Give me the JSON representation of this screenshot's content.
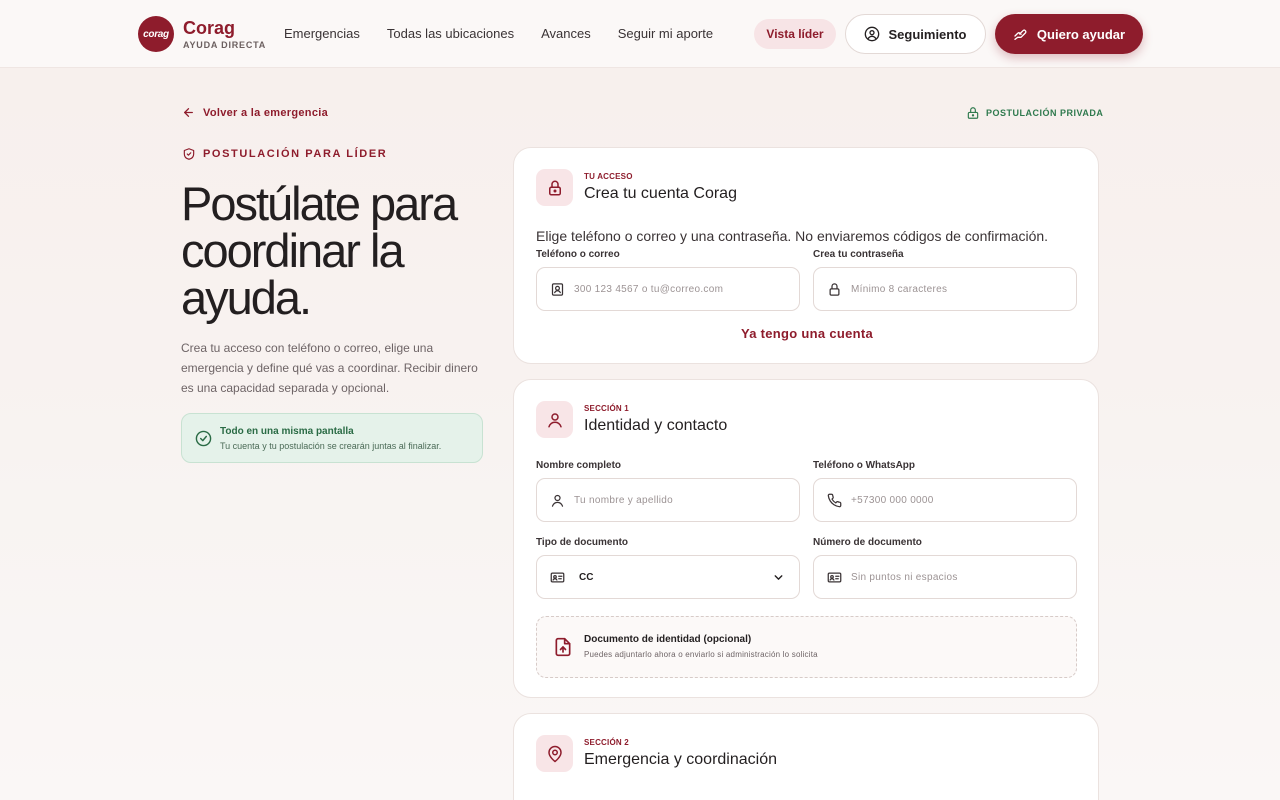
{
  "header": {
    "logo_text": "corag",
    "brand_name": "Corag",
    "brand_sub": "AYUDA DIRECTA",
    "nav": [
      "Emergencias",
      "Todas las ubicaciones",
      "Avances",
      "Seguir mi aporte"
    ],
    "leader_label": "Vista líder",
    "track_label": "Seguimiento",
    "help_label": "Quiero ayudar"
  },
  "top": {
    "back_label": "Volver a la emergencia",
    "private_label": "POSTULACIÓN PRIVADA"
  },
  "hero": {
    "eyebrow": "POSTULACIÓN PARA LÍDER",
    "title": "Postúlate para coordinar la ayuda.",
    "description": "Crea tu acceso con teléfono o correo, elige una emergencia y define qué vas a coordinar. Recibir dinero es una capacidad separada y opcional.",
    "info_title": "Todo en una misma pantalla",
    "info_sub": "Tu cuenta y tu postulación se crearán juntas al finalizar."
  },
  "access_card": {
    "eyebrow": "TU ACCESO",
    "title": "Crea tu cuenta Corag",
    "description": "Elige teléfono o correo y una contraseña. No enviaremos códigos de confirmación.",
    "contact_label": "Teléfono o correo",
    "contact_placeholder": "300 123 4567 o tu@correo.com",
    "password_label": "Crea tu contraseña",
    "password_placeholder": "Mínimo 8 caracteres",
    "login_link": "Ya tengo una cuenta"
  },
  "section1": {
    "eyebrow": "SECCIÓN 1",
    "title": "Identidad y contacto",
    "name_label": "Nombre completo",
    "name_placeholder": "Tu nombre y apellido",
    "phone_label": "Teléfono o WhatsApp",
    "phone_placeholder": "+57300 000 0000",
    "doc_type_label": "Tipo de documento",
    "doc_type_value": "CC",
    "doc_number_label": "Número de documento",
    "doc_number_placeholder": "Sin puntos ni espacios",
    "upload_title": "Documento de identidad (opcional)",
    "upload_sub": "Puedes adjuntarlo ahora o enviarlo si administración lo solicita"
  },
  "section2": {
    "eyebrow": "SECCIÓN 2",
    "title": "Emergencia y coordinación"
  },
  "colors": {
    "brand": "#8e1c2c",
    "success": "#2f7a4e"
  }
}
